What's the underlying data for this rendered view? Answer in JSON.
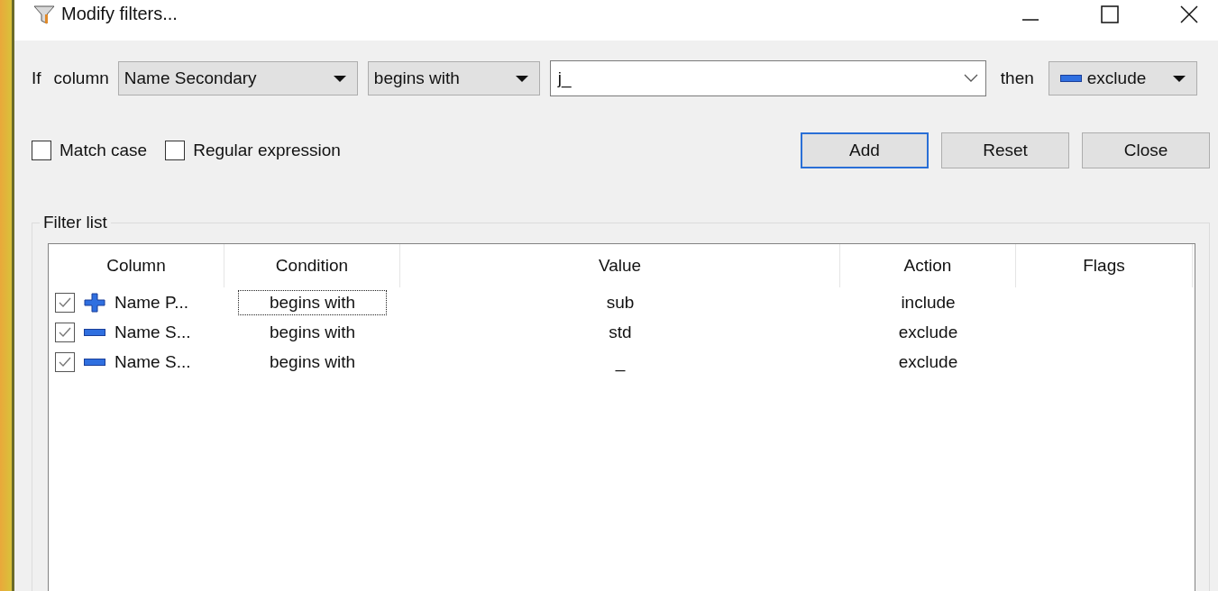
{
  "window": {
    "title": "Modify filters..."
  },
  "rule": {
    "if_label": "If",
    "column_label": "column",
    "column": "Name Secondary",
    "condition": "begins with",
    "value": "j_",
    "then_label": "then",
    "action": {
      "kind": "exclude",
      "label": "exclude"
    }
  },
  "options": [
    {
      "label": "Match case",
      "checked": false
    },
    {
      "label": "Regular expression",
      "checked": false
    }
  ],
  "buttons": [
    {
      "label": "Add",
      "default": true
    },
    {
      "label": "Reset",
      "default": false
    },
    {
      "label": "Close",
      "default": false
    }
  ],
  "filter_list": {
    "title": "Filter list",
    "columns": [
      "Column",
      "Condition",
      "Value",
      "Action",
      "Flags"
    ],
    "rows": [
      {
        "checked": true,
        "kind": "include",
        "column": "Name P...",
        "condition": "begins with",
        "value": "sub",
        "action": "include",
        "focused": true
      },
      {
        "checked": true,
        "kind": "exclude",
        "column": "Name S...",
        "condition": "begins with",
        "value": "std",
        "action": "exclude",
        "focused": false
      },
      {
        "checked": true,
        "kind": "exclude",
        "column": "Name S...",
        "condition": "begins with",
        "value": "_",
        "action": "exclude",
        "focused": false
      }
    ]
  }
}
